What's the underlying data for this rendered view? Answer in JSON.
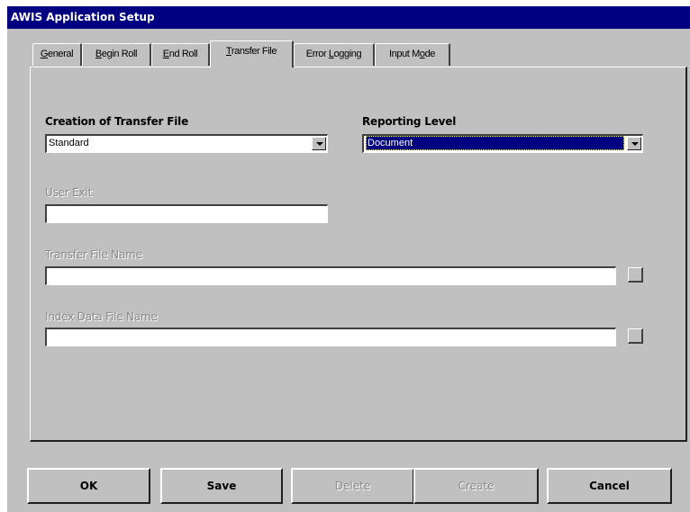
{
  "window": {
    "title": "AWIS Application Setup"
  },
  "tabs": [
    {
      "label": "General",
      "mnemonic": "G",
      "rest": "eneral"
    },
    {
      "label": "Begin Roll",
      "mnemonic": "B",
      "rest": "egin Roll"
    },
    {
      "label": "End Roll",
      "mnemonic": "E",
      "rest": "nd Roll"
    },
    {
      "label": "Transfer File",
      "mnemonic": "T",
      "rest": "ransfer File",
      "active": true
    },
    {
      "label": "Error Logging",
      "pre": "Error ",
      "mnemonic": "L",
      "rest": "ogging"
    },
    {
      "label": "Input Mode",
      "pre": "Input M",
      "mnemonic": "o",
      "rest": "de"
    }
  ],
  "form": {
    "creation_label": "Creation of Transfer File",
    "creation_value": "Standard",
    "reporting_label": "Reporting Level",
    "reporting_value": "Document",
    "user_exit_label": "User Exit",
    "user_exit_value": "",
    "transfer_name_label": "Transfer File Name",
    "transfer_name_value": "",
    "index_name_label": "Index Data File Name",
    "index_name_value": ""
  },
  "buttons": {
    "ok": "OK",
    "save": "Save",
    "delete": "Delete",
    "create": "Create",
    "cancel": "Cancel"
  }
}
